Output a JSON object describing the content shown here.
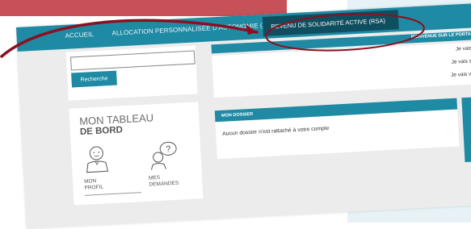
{
  "nav": {
    "items": [
      "ACCUEIL",
      "ALLOCATION PERSONNALISÉE D'AUTONOMIE (APA)"
    ],
    "active": "REVENU DE SOLIDARITÉ ACTIVE (RSA)"
  },
  "welcome": "BIENVENUE SUR LE PORTAIL « RSA » DU",
  "search": {
    "placeholder": "",
    "button": "Recherche"
  },
  "dashboard": {
    "title_line1": "MON TABLEAU",
    "title_line2": "DE BORD",
    "profile_label": [
      "MON",
      "PROFIL"
    ],
    "requests_label": [
      "MES",
      "DEMANDES"
    ]
  },
  "info": {
    "lines": [
      "Je vais lire mon do",
      "Je vais savoir qui est",
      "Je vais voir les action"
    ]
  },
  "dossier": {
    "header": "MON DOSSIER",
    "text": "Aucun dossier n'est rattaché à votre compte"
  },
  "colors": {
    "nav": "#1f8aa3",
    "nav_active": "#0f4e5f",
    "annotation": "#8b1020",
    "banner": "#c65158"
  }
}
